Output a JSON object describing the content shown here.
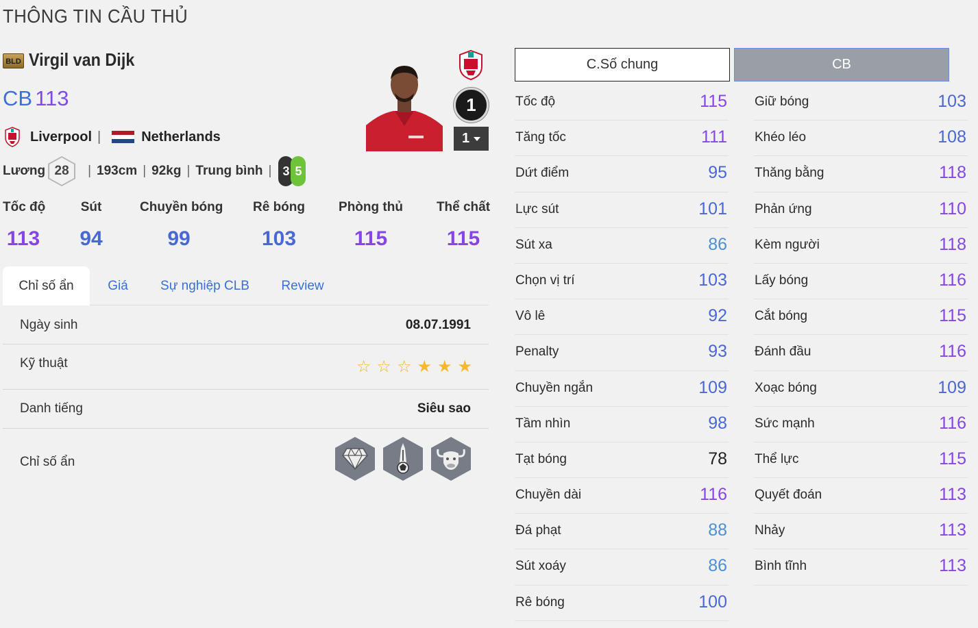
{
  "page_title": "THÔNG TIN CẦU THỦ",
  "player": {
    "season_badge": "BLD",
    "name": "Virgil van Dijk",
    "position": "CB",
    "ovr": "113",
    "club": "Liverpool",
    "nation": "Netherlands",
    "salary_label": "Lương",
    "salary": "28",
    "height": "193cm",
    "weight": "92kg",
    "body_type": "Trung bình",
    "weak_foot_left": "3",
    "weak_foot_right": "5",
    "rank": "1",
    "upgrade_level": "1"
  },
  "summary": [
    {
      "label": "Tốc độ",
      "value": "113"
    },
    {
      "label": "Sút",
      "value": "94"
    },
    {
      "label": "Chuyền bóng",
      "value": "99"
    },
    {
      "label": "Rê bóng",
      "value": "103"
    },
    {
      "label": "Phòng thủ",
      "value": "115"
    },
    {
      "label": "Thể chất",
      "value": "115"
    }
  ],
  "tabs": [
    "Chỉ số ẩn",
    "Giá",
    "Sự nghiệp CLB",
    "Review"
  ],
  "details": {
    "dob_label": "Ngày sinh",
    "dob": "08.07.1991",
    "skill_label": "Kỹ thuật",
    "skill_stars": 3,
    "skill_stars_max": 6,
    "fame_label": "Danh tiếng",
    "fame": "Siêu sao",
    "traits_label": "Chỉ số ẩn",
    "trait_icons": [
      "diamond-trait-icon",
      "tower-trait-icon",
      "bull-trait-icon"
    ]
  },
  "right_tabs": {
    "general": "C.Số chung",
    "position": "CB"
  },
  "stats_left": [
    {
      "label": "Tốc độ",
      "value": "115",
      "color": "purple"
    },
    {
      "label": "Tăng tốc",
      "value": "111",
      "color": "purple"
    },
    {
      "label": "Dứt điểm",
      "value": "95",
      "color": "blue"
    },
    {
      "label": "Lực sút",
      "value": "101",
      "color": "blue"
    },
    {
      "label": "Sút xa",
      "value": "86",
      "color": "light"
    },
    {
      "label": "Chọn vị trí",
      "value": "103",
      "color": "blue"
    },
    {
      "label": "Vô lê",
      "value": "92",
      "color": "blue"
    },
    {
      "label": "Penalty",
      "value": "93",
      "color": "blue"
    },
    {
      "label": "Chuyền ngắn",
      "value": "109",
      "color": "blue"
    },
    {
      "label": "Tầm nhìn",
      "value": "98",
      "color": "blue"
    },
    {
      "label": "Tạt bóng",
      "value": "78",
      "color": "dark"
    },
    {
      "label": "Chuyền dài",
      "value": "116",
      "color": "purple"
    },
    {
      "label": "Đá phạt",
      "value": "88",
      "color": "light"
    },
    {
      "label": "Sút xoáy",
      "value": "86",
      "color": "light"
    },
    {
      "label": "Rê bóng",
      "value": "100",
      "color": "blue"
    }
  ],
  "stats_right": [
    {
      "label": "Giữ bóng",
      "value": "103",
      "color": "blue"
    },
    {
      "label": "Khéo léo",
      "value": "108",
      "color": "blue"
    },
    {
      "label": "Thăng bằng",
      "value": "118",
      "color": "purple"
    },
    {
      "label": "Phản ứng",
      "value": "110",
      "color": "purple"
    },
    {
      "label": "Kèm người",
      "value": "118",
      "color": "purple"
    },
    {
      "label": "Lấy bóng",
      "value": "116",
      "color": "purple"
    },
    {
      "label": "Cắt bóng",
      "value": "115",
      "color": "purple"
    },
    {
      "label": "Đánh đầu",
      "value": "116",
      "color": "purple"
    },
    {
      "label": "Xoạc bóng",
      "value": "109",
      "color": "blue"
    },
    {
      "label": "Sức mạnh",
      "value": "116",
      "color": "purple"
    },
    {
      "label": "Thể lực",
      "value": "115",
      "color": "purple"
    },
    {
      "label": "Quyết đoán",
      "value": "113",
      "color": "purple"
    },
    {
      "label": "Nhảy",
      "value": "113",
      "color": "purple"
    },
    {
      "label": "Bình tĩnh",
      "value": "113",
      "color": "purple"
    }
  ]
}
